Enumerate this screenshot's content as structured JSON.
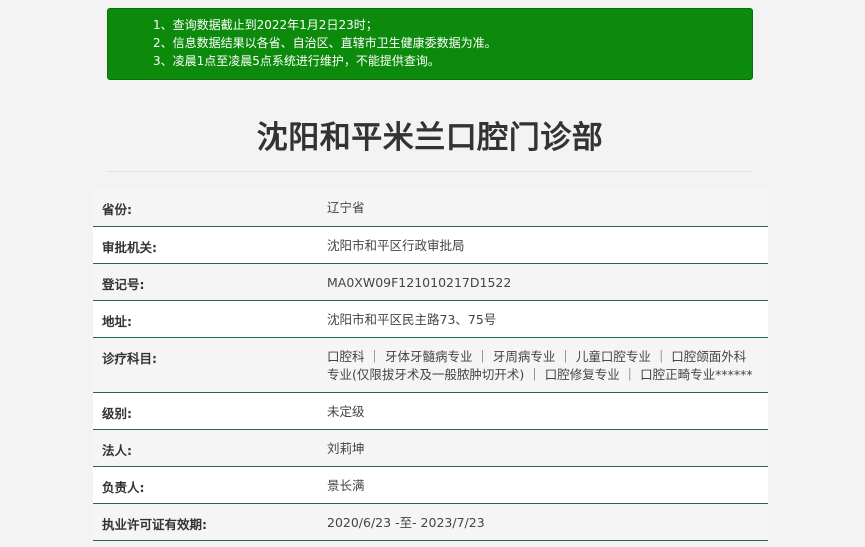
{
  "notice": {
    "lines": [
      "1、查询数据截止到2022年1月2日23时；",
      "2、信息数据结果以各省、自治区、直辖市卫生健康委数据为准。",
      "3、凌晨1点至凌晨5点系统进行维护，不能提供查询。"
    ]
  },
  "title": "沈阳和平米兰口腔门诊部",
  "info": {
    "rows": [
      {
        "label": "省份:",
        "value": "辽宁省"
      },
      {
        "label": "审批机关:",
        "value": "沈阳市和平区行政审批局"
      },
      {
        "label": "登记号:",
        "value": "MA0XW09F121010217D1522"
      },
      {
        "label": "地址:",
        "value": "沈阳市和平区民主路73、75号"
      },
      {
        "label": "诊疗科目:",
        "value": "口腔科 ｜ 牙体牙髓病专业 ｜ 牙周病专业 ｜ 儿童口腔专业 ｜ 口腔颌面外科专业(仅限拔牙术及一般脓肿切开术) ｜ 口腔修复专业 ｜ 口腔正畸专业******"
      },
      {
        "label": "级别:",
        "value": "未定级"
      },
      {
        "label": "法人:",
        "value": "刘莉坤"
      },
      {
        "label": "负责人:",
        "value": "景长满"
      },
      {
        "label": "执业许可证有效期:",
        "value": "2020/6/23 -至- 2023/7/23"
      }
    ]
  }
}
